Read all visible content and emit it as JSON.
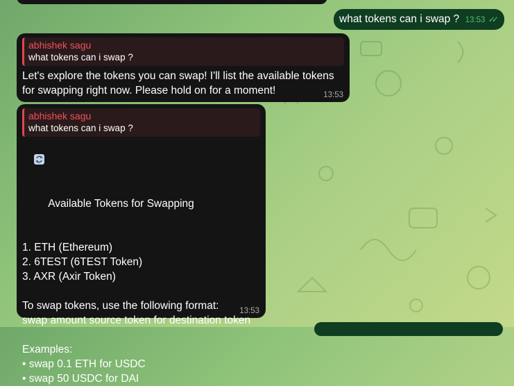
{
  "chat": {
    "outgoing": {
      "text": "what tokens can i swap ?",
      "time": "13:53",
      "status_icon": "double-check-icon"
    },
    "reply1": {
      "quote_author": "abhishek sagu",
      "quote_text": "what tokens can i swap ?",
      "text": "Let's explore the tokens you can swap! I'll list the available tokens\nfor swapping right now. Please hold on for a moment!",
      "time": "13:53"
    },
    "reply2": {
      "quote_author": "abhishek sagu",
      "quote_text": "what tokens can i swap ?",
      "heading": "Available Tokens for Swapping",
      "heading_icon": "swap-icon",
      "body": "\n1. ETH (Ethereum)\n2. 6TEST (6TEST Token)\n3. AXR (Axir Token)\n\nTo swap tokens, use the following format:\nswap amount source token for destination token\n\nExamples:\n• swap 0.1 ETH for USDC\n• swap 50 USDC for DAI",
      "time": "13:53"
    }
  },
  "colors": {
    "incoming_bubble": "#141414",
    "outgoing_bubble": "#0f3d22",
    "reply_accent": "#e0484f",
    "time_outgoing": "#4fbe6f"
  }
}
